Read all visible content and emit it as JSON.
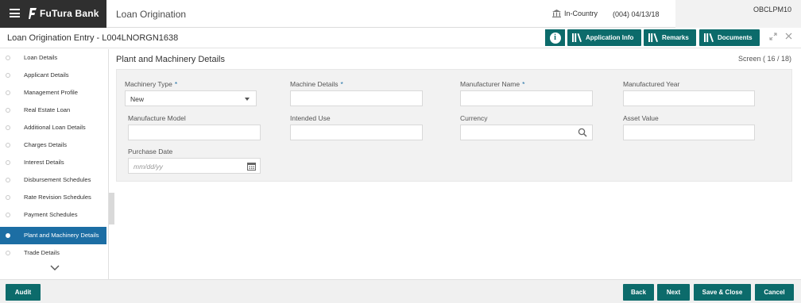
{
  "brand": {
    "name": "FuTura Bank"
  },
  "app": {
    "title": "Loan Origination"
  },
  "topbar": {
    "location": "In-Country",
    "branch": "(004)  04/13/18",
    "user": "OBCLPM10"
  },
  "page": {
    "title": "Loan Origination Entry - L004LNORGN1638"
  },
  "header_buttons": {
    "info": "i",
    "application_info": "Application Info",
    "remarks": "Remarks",
    "documents": "Documents"
  },
  "sidebar": {
    "items": [
      {
        "label": "Loan Details"
      },
      {
        "label": "Applicant Details"
      },
      {
        "label": "Management Profile"
      },
      {
        "label": "Real Estate Loan"
      },
      {
        "label": "Additional Loan Details"
      },
      {
        "label": "Charges Details"
      },
      {
        "label": "Interest Details"
      },
      {
        "label": "Disbursement Schedules"
      },
      {
        "label": "Rate Revision Schedules"
      },
      {
        "label": "Payment Schedules"
      },
      {
        "label": "Plant and Machinery Details"
      },
      {
        "label": "Trade Details"
      }
    ],
    "active_index": 10
  },
  "section": {
    "title": "Plant and Machinery Details",
    "screen": "Screen ( 16 / 18)"
  },
  "form": {
    "machinery_type": {
      "label": "Machinery Type",
      "value": "New",
      "required": "*"
    },
    "machine_details": {
      "label": "Machine Details",
      "value": "",
      "required": "*"
    },
    "manufacturer_name": {
      "label": "Manufacturer Name",
      "value": "",
      "required": "*"
    },
    "manufactured_year": {
      "label": "Manufactured Year",
      "value": ""
    },
    "manufacture_model": {
      "label": "Manufacture Model",
      "value": ""
    },
    "intended_use": {
      "label": "Intended Use",
      "value": ""
    },
    "currency": {
      "label": "Currency",
      "value": ""
    },
    "asset_value": {
      "label": "Asset Value",
      "value": ""
    },
    "purchase_date": {
      "label": "Purchase Date",
      "placeholder": "mm/dd/yy"
    }
  },
  "footer": {
    "audit": "Audit",
    "back": "Back",
    "next": "Next",
    "save_close": "Save & Close",
    "cancel": "Cancel"
  },
  "colors": {
    "primary": "#0c6b6b",
    "active_nav": "#1c6ea4",
    "brand_bg": "#2f2f2f"
  }
}
